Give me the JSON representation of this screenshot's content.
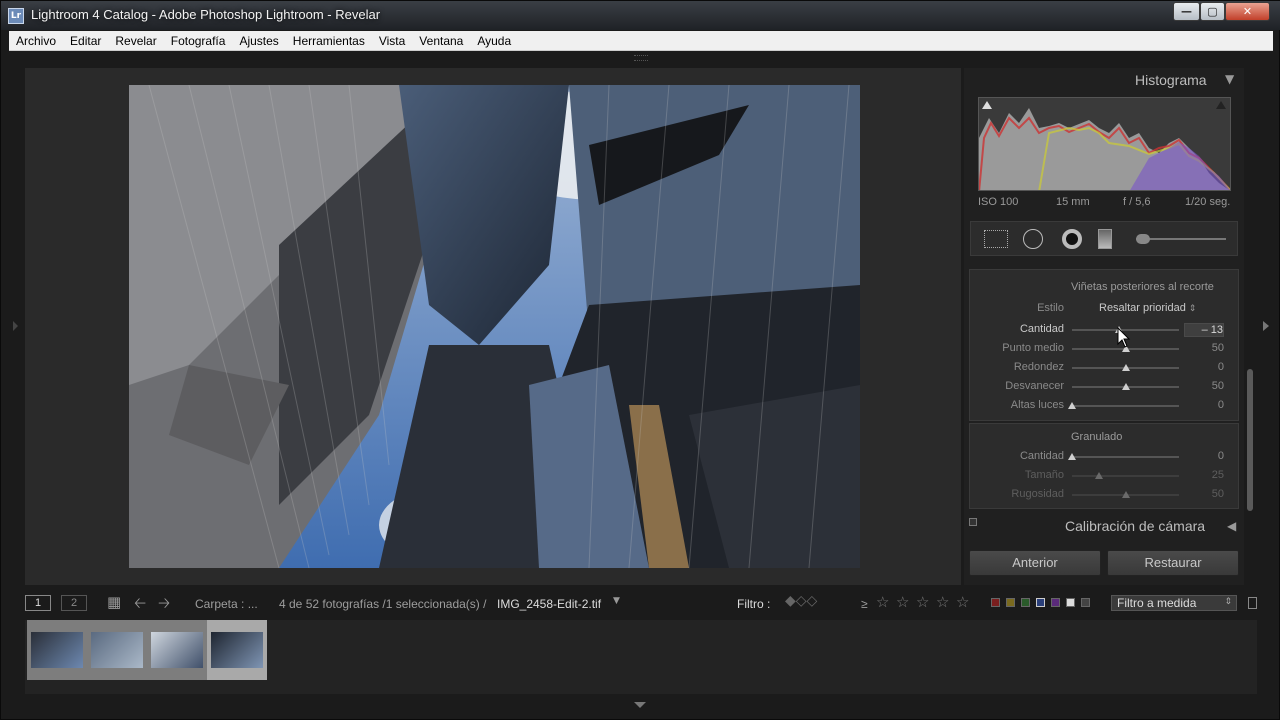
{
  "window": {
    "app_badge": "Lr",
    "title": "Lightroom 4 Catalog - Adobe Photoshop Lightroom - Revelar"
  },
  "menu": [
    "Archivo",
    "Editar",
    "Revelar",
    "Fotografía",
    "Ajustes",
    "Herramientas",
    "Vista",
    "Ventana",
    "Ayuda"
  ],
  "histogram": {
    "title": "Histograma",
    "iso": "ISO 100",
    "focal": "15 mm",
    "aperture": "f / 5,6",
    "shutter": "1/20 seg."
  },
  "vignette": {
    "title": "Viñetas posteriores al recorte",
    "style_label": "Estilo",
    "style_value": "Resaltar prioridad",
    "sliders": [
      {
        "label": "Cantidad",
        "value": "– 13",
        "level": -13
      },
      {
        "label": "Punto medio",
        "value": "50",
        "level": 50
      },
      {
        "label": "Redondez",
        "value": "0",
        "level": 0
      },
      {
        "label": "Desvanecer",
        "value": "50",
        "level": 50
      },
      {
        "label": "Altas luces",
        "value": "0",
        "level": 0
      }
    ]
  },
  "grain": {
    "title": "Granulado",
    "sliders": [
      {
        "label": "Cantidad",
        "value": "0",
        "level": 0
      },
      {
        "label": "Tamaño",
        "value": "25",
        "level": 25
      },
      {
        "label": "Rugosidad",
        "value": "50",
        "level": 50
      }
    ]
  },
  "calibration": {
    "title": "Calibración de cámara"
  },
  "buttons": {
    "previous": "Anterior",
    "reset": "Restaurar"
  },
  "filmbar": {
    "monitor1": "1",
    "monitor2": "2",
    "folder": "Carpeta : ...",
    "count": "4 de 52 fotografías /1 seleccionada(s) /",
    "filename": "IMG_2458-Edit-2.tif",
    "filter_label": "Filtro :",
    "gte": "≥",
    "filter_preset": "Filtro a medida"
  },
  "colors": {
    "panel_bg": "#202020",
    "section_bg": "#2c2c2c",
    "title_bar": "#1f2226",
    "close_red": "#c2402a"
  }
}
